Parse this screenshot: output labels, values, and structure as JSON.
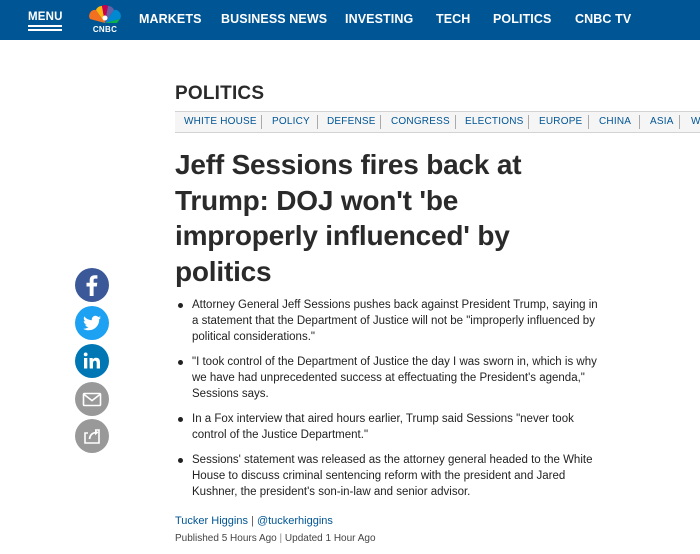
{
  "topnav": {
    "menu_label": "MENU",
    "logo_text": "CNBC",
    "items": [
      "MARKETS",
      "BUSINESS NEWS",
      "INVESTING",
      "TECH",
      "POLITICS",
      "CNBC TV"
    ]
  },
  "section": {
    "title": "POLITICS",
    "subnav": [
      "WHITE HOUSE",
      "POLICY",
      "DEFENSE",
      "CONGRESS",
      "ELECTIONS",
      "EUROPE",
      "CHINA",
      "ASIA",
      "WORLD"
    ]
  },
  "article": {
    "headline_lines": [
      "Jeff Sessions fires back at",
      "Trump: DOJ won't 'be",
      "improperly influenced' by",
      "politics"
    ],
    "bullets": [
      [
        "Attorney General Jeff Sessions pushes back against President Trump, saying in",
        "a statement that the Department of Justice will not be \"improperly influenced by",
        "political considerations.\""
      ],
      [
        "\"I took control of the Department of Justice the day I was sworn in, which is why",
        "we have had unprecedented success at effectuating the President's agenda,\"",
        "Sessions says."
      ],
      [
        "In a Fox interview that aired hours earlier, Trump said Sessions \"never took",
        "control of the Justice Department.\""
      ],
      [
        "Sessions' statement was released as the attorney general headed to the White",
        "House to discuss criminal sentencing reform with the president and Jared",
        "Kushner, the president's son-in-law and senior advisor."
      ]
    ],
    "author": "Tucker Higgins",
    "author_separator": "|",
    "author_handle": "@tuckerhiggins",
    "published": "Published 5 Hours Ago",
    "date_separator": "|",
    "updated": "Updated 1 Hour Ago"
  },
  "social": [
    {
      "name": "facebook",
      "icon": "facebook-icon",
      "color": "#3b5998"
    },
    {
      "name": "twitter",
      "icon": "twitter-icon",
      "color": "#1da1f2"
    },
    {
      "name": "linkedin",
      "icon": "linkedin-icon",
      "color": "#0077b5"
    },
    {
      "name": "email",
      "icon": "email-icon",
      "color": "#999999"
    },
    {
      "name": "share",
      "icon": "share-icon",
      "color": "#999999"
    }
  ],
  "colors": {
    "brand_blue": "#005594",
    "text": "#2a2a2a"
  }
}
